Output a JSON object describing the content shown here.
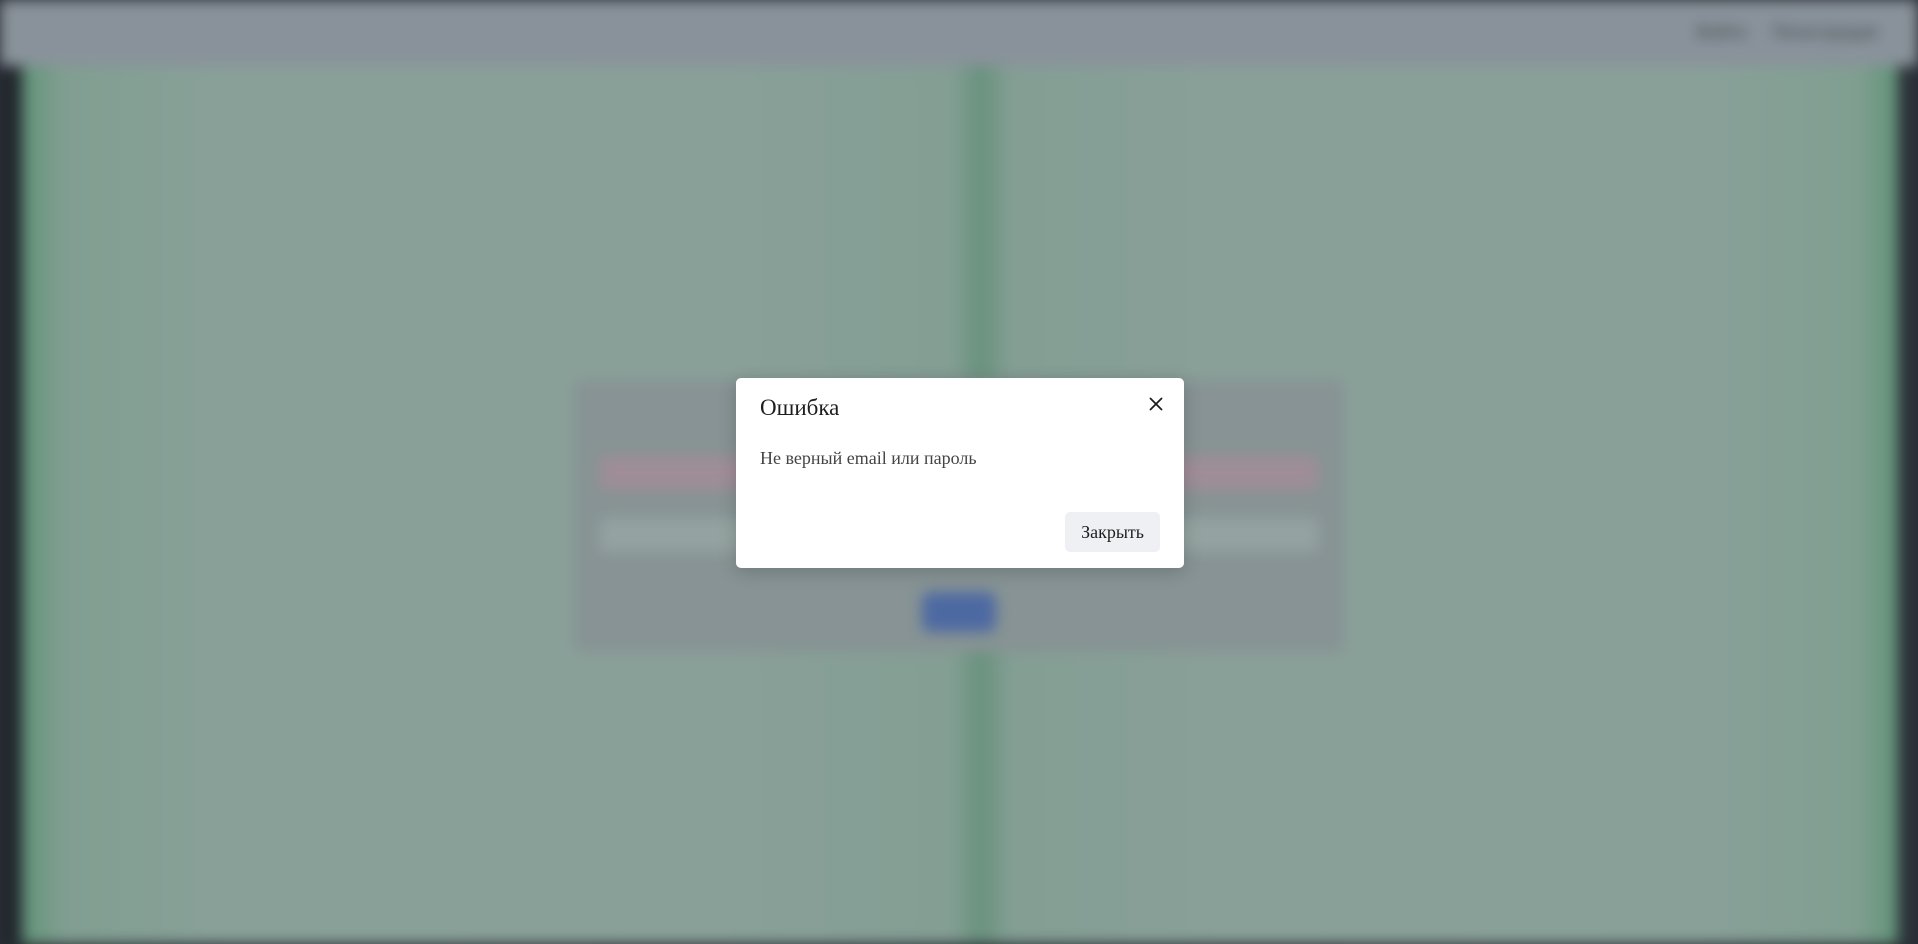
{
  "header": {
    "nav_links": [
      "Войти",
      "Регистрация"
    ]
  },
  "modal": {
    "title": "Ошибка",
    "message": "Не верный email или пароль",
    "close_icon": "close-icon",
    "close_button_label": "Закрыть"
  },
  "colors": {
    "overlay": "#3c4650",
    "modal_bg": "#ffffff",
    "button_bg": "#eef0f3",
    "background_green": "#c9e9d4",
    "login_submit": "#5b86e6"
  }
}
